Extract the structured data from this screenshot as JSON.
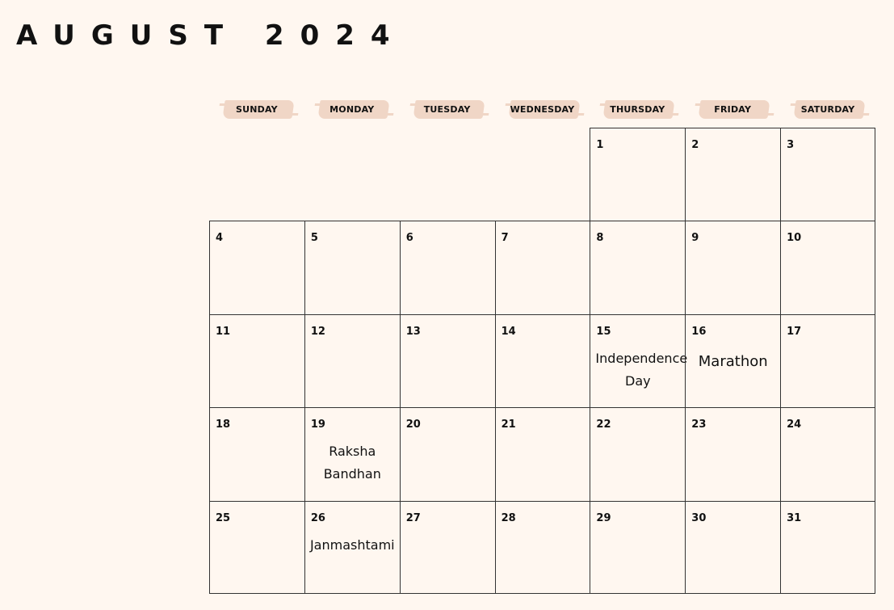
{
  "calendar": {
    "title": "AUGUST 2024",
    "weekdays": [
      "SUNDAY",
      "MONDAY",
      "TUESDAY",
      "WEDNESDAY",
      "THURSDAY",
      "FRIDAY",
      "SATURDAY"
    ],
    "days": [
      "1",
      "2",
      "3",
      "4",
      "5",
      "6",
      "7",
      "8",
      "9",
      "10",
      "11",
      "12",
      "13",
      "14",
      "15",
      "16",
      "17",
      "18",
      "19",
      "20",
      "21",
      "22",
      "23",
      "24",
      "25",
      "26",
      "27",
      "28",
      "29",
      "30",
      "31"
    ],
    "events": {
      "15": "Independence Day",
      "16": "Marathon",
      "19": "Raksha Bandhan",
      "26": "Janmashtami"
    }
  }
}
